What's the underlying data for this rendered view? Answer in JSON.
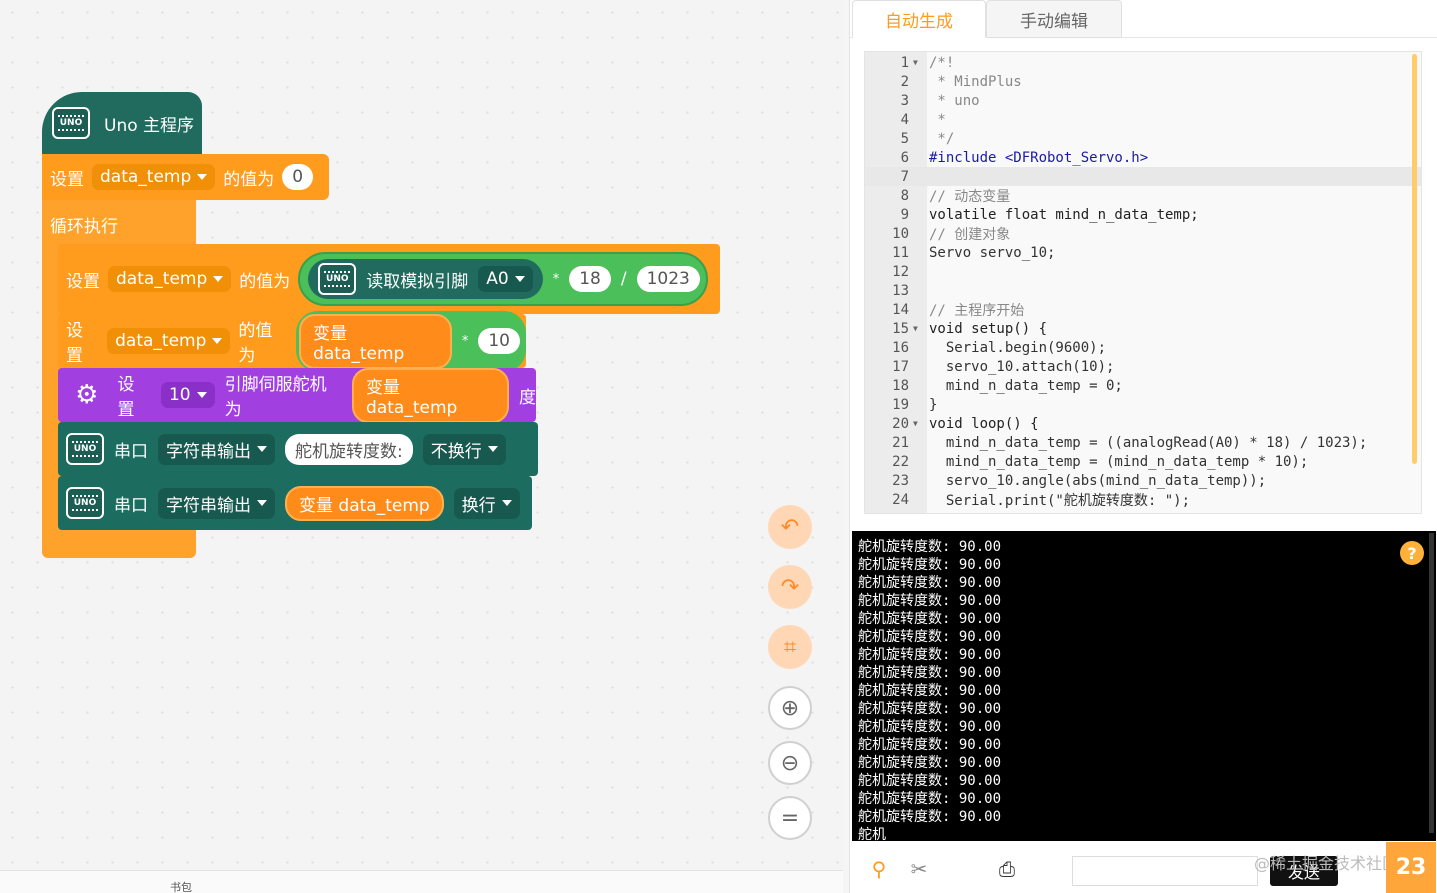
{
  "workspace": {
    "main_hat_label": "Uno 主程序",
    "uno_badge": "UNO",
    "set_label": "设置",
    "var_name": "data_temp",
    "value_label": "的值为",
    "init_value": "0",
    "loop_label": "循环执行",
    "read_analog_label": "读取模拟引脚",
    "analog_pin": "A0",
    "multiply": "*",
    "divide": "/",
    "num18": "18",
    "num1023": "1023",
    "var_ref_label": "变量 data_temp",
    "num10": "10",
    "servo_pin": "10",
    "servo_label": "引脚伺服舵机为",
    "degree_label": "度",
    "serial_label": "串口",
    "string_output": "字符串输出",
    "text_value": "舵机旋转度数:",
    "no_newline": "不换行",
    "newline": "换行",
    "bottom_text": "书包"
  },
  "tabs": {
    "auto": "自动生成",
    "manual": "手动编辑"
  },
  "code_lines": [
    "/*!",
    " * MindPlus",
    " * uno",
    " *",
    " */",
    "#include <DFRobot_Servo.h>",
    "",
    "// 动态变量",
    "volatile float mind_n_data_temp;",
    "// 创建对象",
    "Servo servo_10;",
    "",
    "",
    "// 主程序开始",
    "void setup() {",
    "  Serial.begin(9600);",
    "  servo_10.attach(10);",
    "  mind_n_data_temp = 0;",
    "}",
    "void loop() {",
    "  mind_n_data_temp = ((analogRead(A0) * 18) / 1023);",
    "  mind_n_data_temp = (mind_n_data_temp * 10);",
    "  servo_10.angle(abs(mind_n_data_temp));",
    "  Serial.print(\"舵机旋转度数: \");"
  ],
  "serial_lines": [
    "舵机旋转度数: 90.00",
    "舵机旋转度数: 90.00",
    "舵机旋转度数: 90.00",
    "舵机旋转度数: 90.00",
    "舵机旋转度数: 90.00",
    "舵机旋转度数: 90.00",
    "舵机旋转度数: 90.00",
    "舵机旋转度数: 90.00",
    "舵机旋转度数: 90.00",
    "舵机旋转度数: 90.00",
    "舵机旋转度数: 90.00",
    "舵机旋转度数: 90.00",
    "舵机旋转度数: 90.00",
    "舵机旋转度数: 90.00",
    "舵机旋转度数: 90.00",
    "舵机旋转度数: 90.00",
    "舵机"
  ],
  "help_label": "?",
  "send_label": "发送",
  "watermark": "@稀土掘金技术社区",
  "logo_text": "23",
  "tools": {
    "undo": "↶",
    "redo": "↷",
    "crop": "⌗",
    "zoom_in": "⊕",
    "zoom_out": "⊖",
    "reset": "="
  },
  "colors": {
    "accent": "#ff9b1d",
    "block_orange": "#ff9b1d",
    "block_teal": "#206a5e",
    "block_purple": "#a13fe0",
    "block_green": "#4bbf5a"
  }
}
